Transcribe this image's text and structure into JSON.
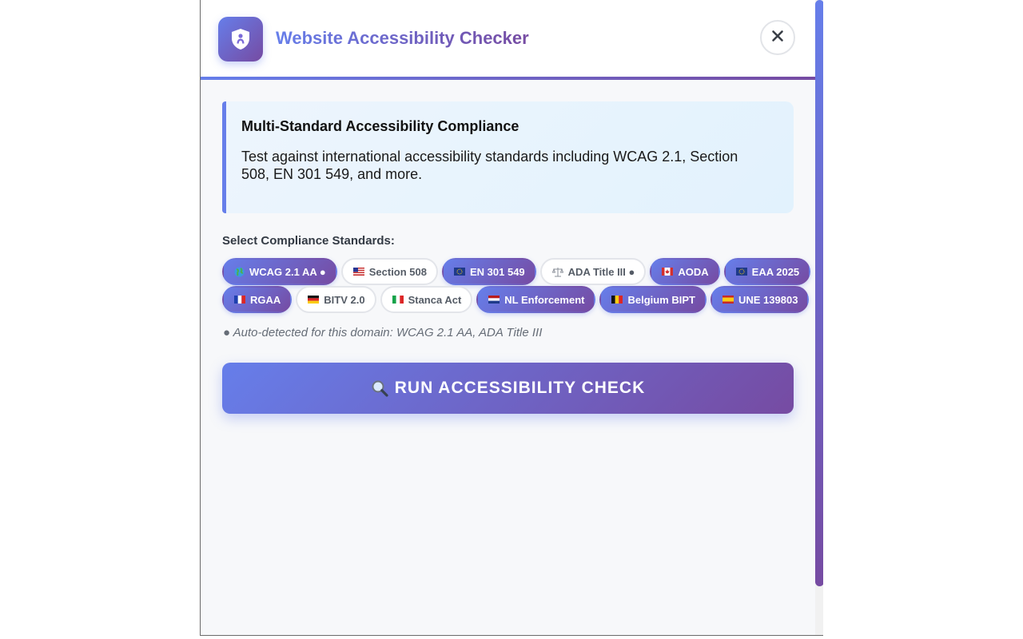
{
  "header": {
    "title": "Website Accessibility Checker",
    "icon": "shield-person-icon",
    "close_icon": "close-icon"
  },
  "info": {
    "title": "Multi-Standard Accessibility Compliance",
    "text": "Test against international accessibility standards including WCAG 2.1, Section 508, EN 301 549, and more."
  },
  "standards": {
    "label": "Select Compliance Standards:",
    "rows": [
      [
        {
          "label": "WCAG 2.1 AA ●",
          "flag": "globe-icon",
          "selected": true
        },
        {
          "label": "Section 508",
          "flag": "us-flag-icon",
          "selected": false
        },
        {
          "label": "EN 301 549",
          "flag": "eu-flag-icon",
          "selected": true
        },
        {
          "label": "ADA Title III ●",
          "flag": "scales-icon",
          "selected": false
        },
        {
          "label": "AODA",
          "flag": "canada-flag-icon",
          "selected": true
        },
        {
          "label": "EAA 2025",
          "flag": "eu-flag-icon",
          "selected": true
        }
      ],
      [
        {
          "label": "RGAA",
          "flag": "france-flag-icon",
          "selected": true
        },
        {
          "label": "BITV 2.0",
          "flag": "germany-flag-icon",
          "selected": false
        },
        {
          "label": "Stanca Act",
          "flag": "italy-flag-icon",
          "selected": false
        },
        {
          "label": "NL Enforcement",
          "flag": "netherlands-flag-icon",
          "selected": true
        },
        {
          "label": "Belgium BIPT",
          "flag": "belgium-flag-icon",
          "selected": true
        },
        {
          "label": "UNE 139803",
          "flag": "spain-flag-icon",
          "selected": true
        }
      ]
    ],
    "auto_note": "● Auto-detected for this domain: WCAG 2.1 AA, ADA Title III"
  },
  "run_button": {
    "label": "RUN ACCESSIBILITY CHECK",
    "icon": "magnifier-icon"
  },
  "colors": {
    "accent_start": "#667eea",
    "accent_end": "#764ba2",
    "info_bg": "#e6f3fd",
    "chip_off_border": "#e3e5ea"
  }
}
